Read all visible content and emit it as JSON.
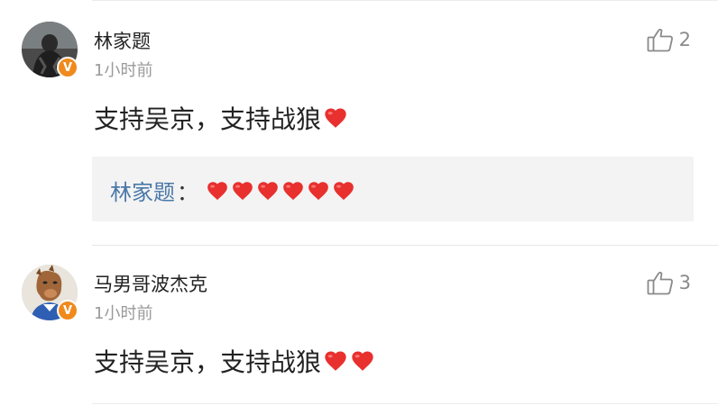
{
  "comments": [
    {
      "username": "林家题",
      "timestamp": "1小时前",
      "likes": "2",
      "text": "支持吴京，支持战狼",
      "heart_count": 1,
      "verified_badge": "V",
      "replies": [
        {
          "author": "林家题",
          "colon": "：",
          "heart_count": 6
        }
      ]
    },
    {
      "username": "马男哥波杰克",
      "timestamp": "1小时前",
      "likes": "3",
      "text": "支持吴京，支持战狼",
      "heart_count": 2,
      "verified_badge": "V"
    }
  ],
  "icons": {
    "like": "thumbs-up-outline-icon",
    "heart": "red-heart-emoji-icon",
    "verified": "verified-v-badge-icon"
  },
  "colors": {
    "username": "#222222",
    "timestamp": "#9a9a9a",
    "reply_author": "#4a78a8",
    "reply_background": "#f3f3f3",
    "heart": "#e8302e",
    "verified_badge": "#f08a1c",
    "like_icon": "#8a8a8a"
  }
}
